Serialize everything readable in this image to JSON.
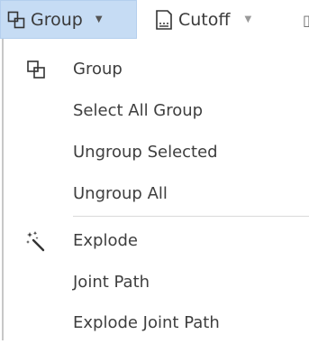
{
  "toolbar": {
    "group_label": "Group",
    "cutoff_label": "Cutoff",
    "group_icon": "group-icon",
    "cutoff_icon": "cutoff-icon",
    "dropdown_icon": "dropdown-arrow-icon",
    "active_color": "#c6dcf4"
  },
  "menu": {
    "items": [
      {
        "label": "Group",
        "icon": "group-icon"
      },
      {
        "label": "Select All Group"
      },
      {
        "label": "Ungroup Selected"
      },
      {
        "label": "Ungroup All"
      },
      {
        "label": "Explode",
        "icon": "magic-wand-icon"
      },
      {
        "label": "Joint Path"
      },
      {
        "label": "Explode Joint Path"
      }
    ]
  }
}
